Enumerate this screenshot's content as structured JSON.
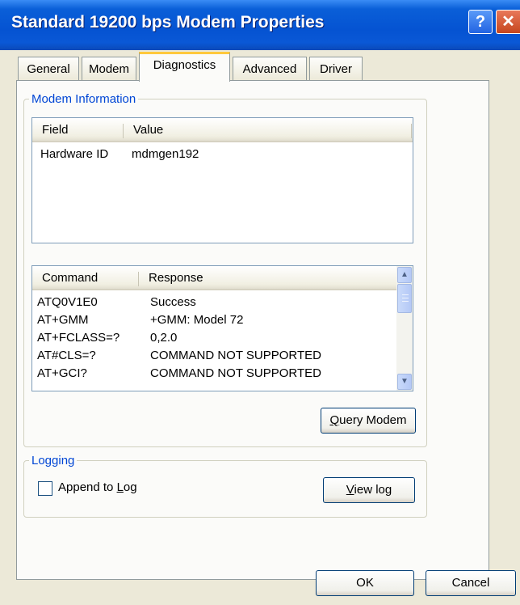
{
  "window": {
    "title": "Standard 19200 bps Modem Properties",
    "help_glyph": "?",
    "close_glyph": "✕"
  },
  "tabs": [
    {
      "label": "General"
    },
    {
      "label": "Modem"
    },
    {
      "label": "Diagnostics",
      "active": true
    },
    {
      "label": "Advanced"
    },
    {
      "label": "Driver"
    }
  ],
  "modem_information": {
    "legend": "Modem Information",
    "info_list": {
      "columns": [
        "Field",
        "Value"
      ],
      "rows": [
        {
          "field": "Hardware ID",
          "value": "mdmgen192"
        }
      ]
    },
    "command_list": {
      "columns": [
        "Command",
        "Response"
      ],
      "rows": [
        {
          "command": "ATQ0V1E0",
          "response": "Success"
        },
        {
          "command": "AT+GMM",
          "response": "+GMM: Model 72"
        },
        {
          "command": "AT+FCLASS=?",
          "response": "0,2.0"
        },
        {
          "command": "AT#CLS=?",
          "response": "COMMAND NOT SUPPORTED"
        },
        {
          "command": "AT+GCI?",
          "response": "COMMAND NOT SUPPORTED"
        }
      ]
    },
    "query_button": {
      "mnemonic": "Q",
      "rest": "uery Modem"
    }
  },
  "logging": {
    "legend": "Logging",
    "append_checkbox": {
      "checked": false,
      "pre": "Append to ",
      "mnemonic": "L",
      "post": "og"
    },
    "view_log_button": {
      "mnemonic": "V",
      "rest": "iew log"
    }
  },
  "footer": {
    "ok_label": "OK",
    "cancel_label": "Cancel"
  },
  "colors": {
    "title_bar": "#0553d2",
    "group_legend": "#0046d5",
    "active_tab_highlight": "#ffc83c",
    "dialog_face": "#ece9d8"
  }
}
